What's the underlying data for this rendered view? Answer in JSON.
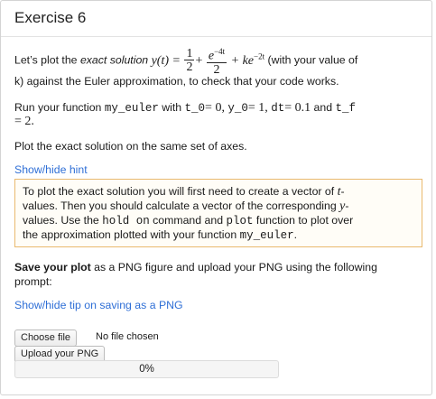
{
  "title": "Exercise 6",
  "para1": {
    "lets_plot_the": "Let’s plot the ",
    "exact_solution": "exact solution",
    "y_of_t": "y(t) =",
    "half_num": "1",
    "half_den": "2",
    "plus1": "+",
    "exp_num_base": "e",
    "exp_num_sup": "−4t",
    "exp_den": "2",
    "plus2": "+ ke",
    "exp2_sup": "−2t",
    "with_text": "(with your value of",
    "line2": "k) against the Euler approximation, to check that your code works."
  },
  "para2": {
    "run": "Run your function ",
    "fn": "my_euler",
    "with": " with ",
    "t0": "t_0",
    "eq1": "= 0,",
    "y0": "y_0",
    "eq2": "= 1,",
    "dt": "dt",
    "eq3": "= 0.1",
    "and": " and ",
    "tf": "t_f",
    "line2": "= 2."
  },
  "para3": "Plot the exact solution on the same set of axes.",
  "hint_toggle": "Show/hide hint",
  "hint": {
    "l1": "To plot the exact solution you will first need to create a vector of ",
    "l1_t": "t",
    "l1_end": "-",
    "l2a": "values. Then you should calculate a vector of the corresponding ",
    "l2_y": "y",
    "l2_end": "-",
    "l3a": "values. Use the ",
    "hold": "hold on",
    "l3b": " command and ",
    "plot": "plot",
    "l3c": " function to plot over",
    "l4a": "the approximation plotted with your function ",
    "l4_fn": "my_euler",
    "l4_end": "."
  },
  "save": {
    "bold": "Save your plot",
    "rest": " as a PNG figure and upload your PNG using the following",
    "line2": "prompt:"
  },
  "tip_toggle": "Show/hide tip on saving as a PNG",
  "upload": {
    "choose": "Choose file",
    "no_file": "No file chosen",
    "upload_btn": "Upload your PNG",
    "progress_label": "0%",
    "progress_value": 0
  }
}
